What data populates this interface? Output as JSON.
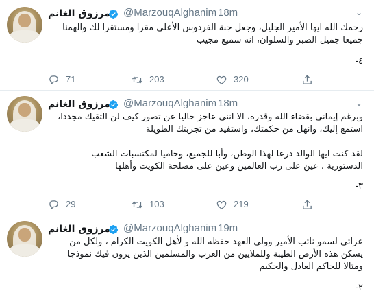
{
  "tweets": [
    {
      "name": "مرزوق الغانم",
      "handle": "@MarzouqAlghanim",
      "separator": "·",
      "time": "18m",
      "lines": [
        "رحمك الله ايها الأمير الجليل، وجعل جنة الفردوس الأعلى مقرا ومستقرا لك والهمنا",
        "جميعا جميل الصبر والسلوان، انه سميع مجيب"
      ],
      "counter": "٤-",
      "replies": "71",
      "retweets": "203",
      "likes": "320"
    },
    {
      "name": "مرزوق الغانم",
      "handle": "@MarzouqAlghanim",
      "separator": "·",
      "time": "18m",
      "lines": [
        "وبرغم إيماني بقضاء الله وقدره، الا انني عاجز حاليا عن تصور كيف لن التقيك مجددا،",
        "استمع إليك، وانهل من حكمتك، واستفيد من تجربتك الطويلة",
        "",
        "لقد كنت ايها الوالد درعا لهذا الوطن، وأبا للجميع، وحاميا لمكتسبات الشعب",
        "الدستورية ، عين على رب العالمين وعين على مصلحة الكويت وأهلها"
      ],
      "counter": "٣-",
      "replies": "29",
      "retweets": "103",
      "likes": "219"
    },
    {
      "name": "مرزوق الغانم",
      "handle": "@MarzouqAlghanim",
      "separator": "·",
      "time": "19m",
      "lines": [
        "عزائي لسمو نائب الأمير وولي العهد حفظه الله و لأهل الكويت الكرام ، ولكل من",
        "يسكن هذه الأرض الطيبة وللملايين من العرب والمسلمين الذين يرون فيك نموذجا",
        "ومثالا للحاكم العادل والحكيم"
      ],
      "counter": "٢-",
      "replies": "",
      "retweets": "",
      "likes": ""
    }
  ],
  "icons": {
    "verified_color": "#1da1f2",
    "action_color": "#657786"
  }
}
